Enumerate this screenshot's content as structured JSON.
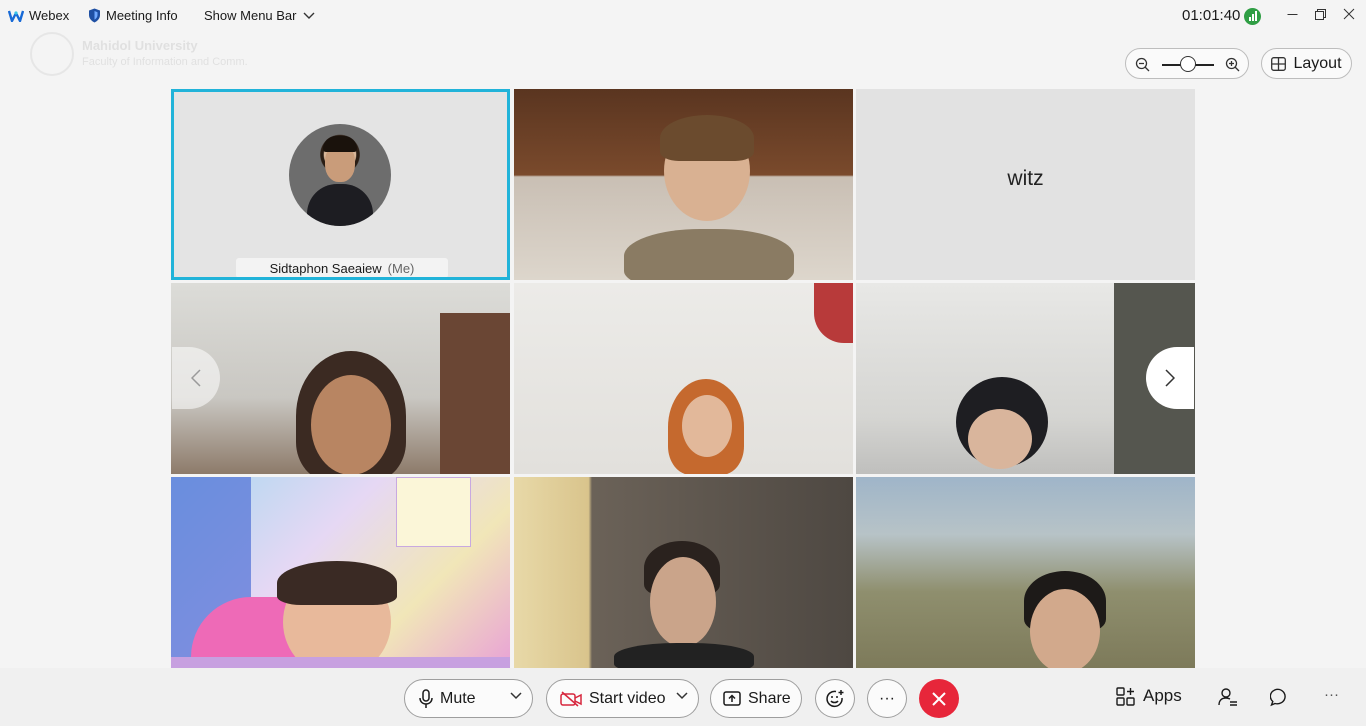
{
  "titlebar": {
    "app_name": "Webex",
    "meeting_info": "Meeting Info",
    "show_menu_bar": "Show Menu Bar",
    "clock": "01:01:40"
  },
  "watermark": {
    "line1": "Mahidol University",
    "line2": "Faculty of Information and Comm."
  },
  "toolbar_top": {
    "layout_label": "Layout",
    "zoom_level": 0.4
  },
  "tiles": [
    {
      "type": "avatar",
      "name": "Sidtaphon Saeaiew",
      "suffix": "(Me)",
      "active": true
    },
    {
      "type": "video"
    },
    {
      "type": "name",
      "name": "witz"
    },
    {
      "type": "video"
    },
    {
      "type": "video"
    },
    {
      "type": "video"
    },
    {
      "type": "video"
    },
    {
      "type": "video"
    },
    {
      "type": "video"
    }
  ],
  "controls": {
    "mute": "Mute",
    "start_video": "Start video",
    "share": "Share",
    "more": "···",
    "apps": "Apps",
    "overflow": "···"
  },
  "colors": {
    "active_border": "#21b3d9",
    "end_call": "#e7263a",
    "signal": "#2f9e44"
  }
}
